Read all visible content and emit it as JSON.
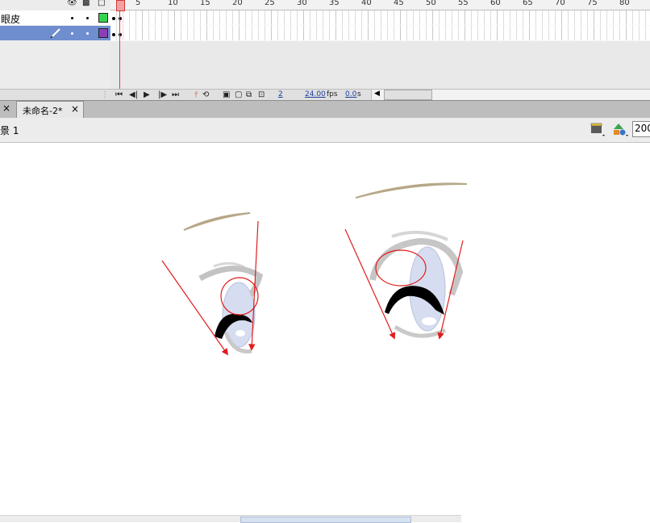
{
  "timeline": {
    "header_icons": {
      "eye": "eye-icon",
      "lock": "lock-icon",
      "outline": "outline-square-icon"
    },
    "layers": [
      {
        "name": "眼皮",
        "color": "#33d44f"
      },
      {
        "name": "",
        "color": "#8b3fb5",
        "active": true
      }
    ],
    "ruler_numbers": [
      "5",
      "10",
      "15",
      "20",
      "25",
      "30",
      "35",
      "40",
      "45",
      "50",
      "55",
      "60",
      "65",
      "70",
      "75",
      "80"
    ],
    "controls": {
      "current_frame": "2",
      "fps_value": "24.00",
      "fps_unit": "fps",
      "time_value": "0.0",
      "time_unit": "s"
    }
  },
  "tabs": {
    "close_glyph": "×",
    "document": {
      "label": "未命名-2*",
      "close": "×"
    }
  },
  "editbar": {
    "scene_label": "景 1",
    "zoom_value": "200"
  },
  "colors": {
    "playhead": "#e23b3b",
    "active_layer": "#6f8ecf",
    "arrow": "#e21b1b",
    "eyebrow": "#b7a787",
    "iris": "#d7ddf0",
    "lash": "#000000"
  }
}
